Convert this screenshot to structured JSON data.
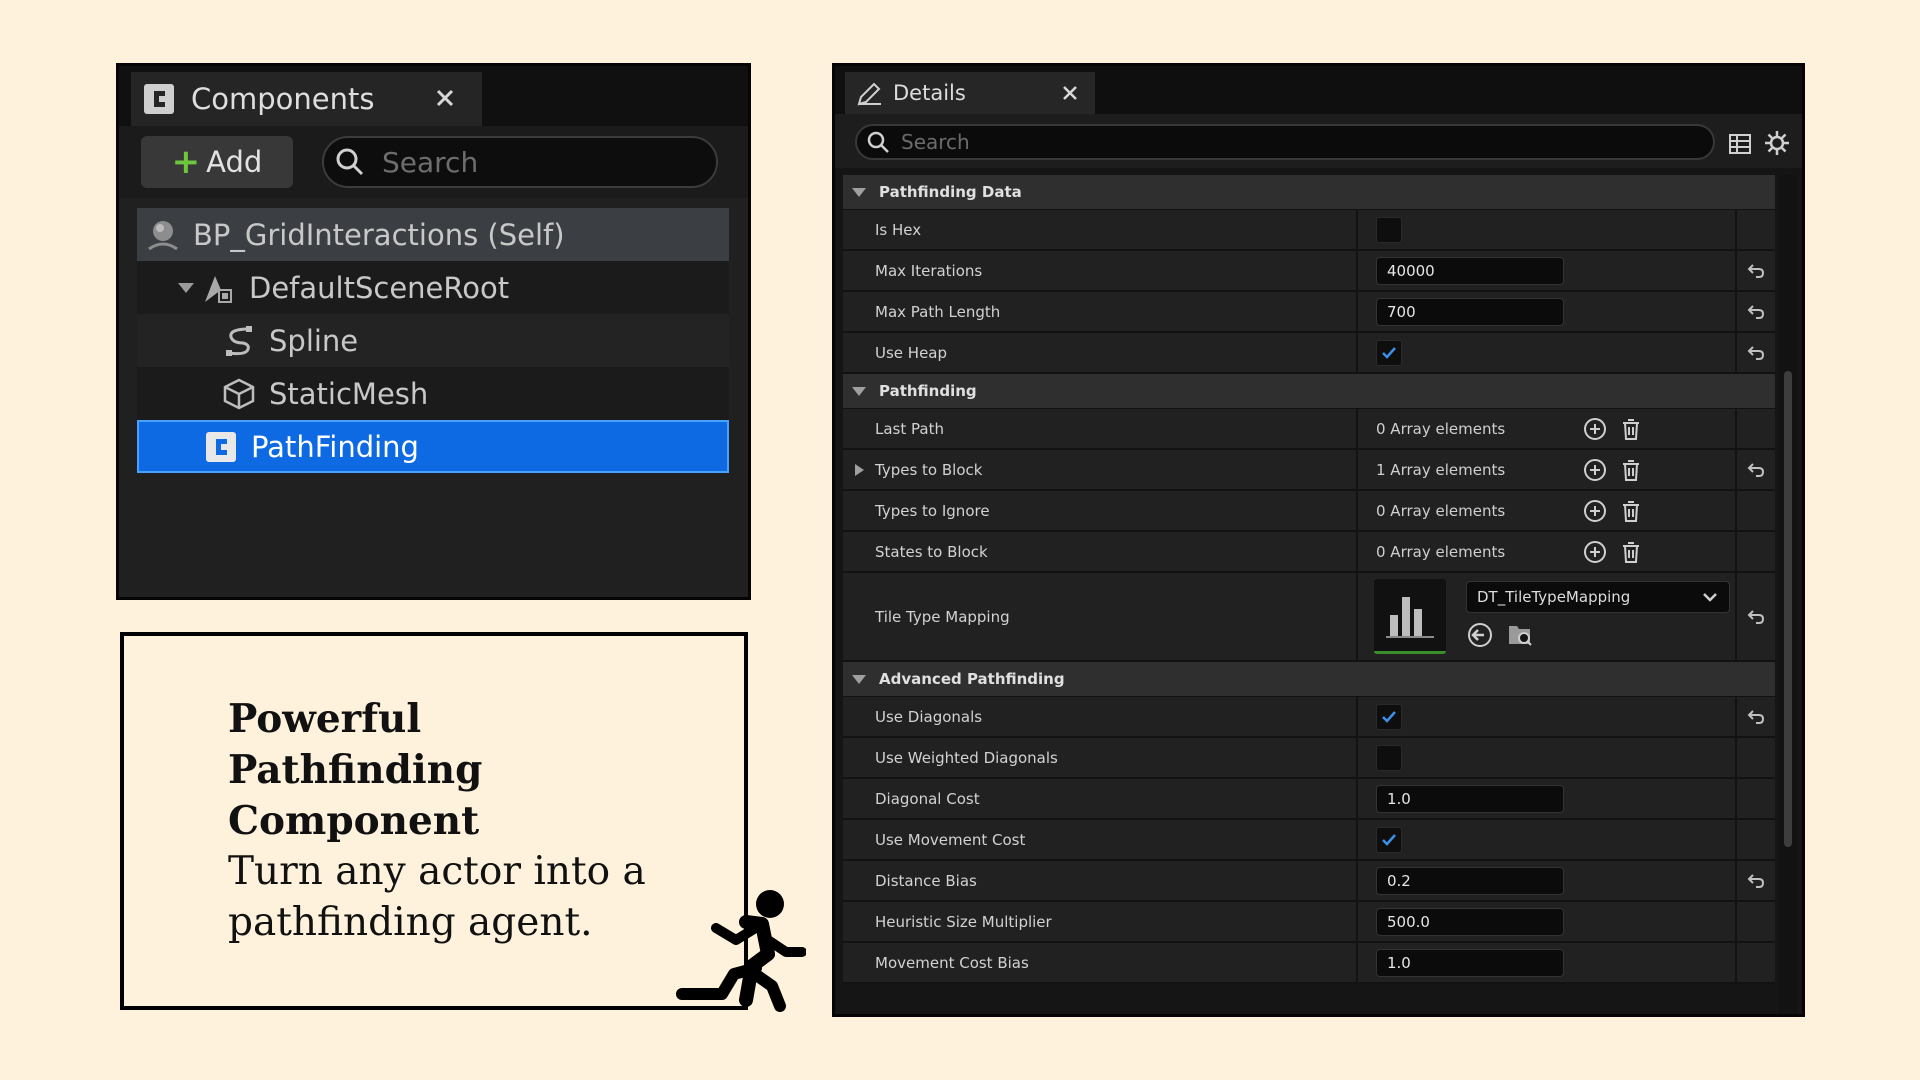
{
  "components_panel": {
    "tab_title": "Components",
    "add_label": "Add",
    "search_placeholder": "Search",
    "tree": [
      {
        "label": "BP_GridInteractions (Self)",
        "icon": "blueprint-self-icon"
      },
      {
        "label": "DefaultSceneRoot",
        "icon": "scene-root-icon"
      },
      {
        "label": "Spline",
        "icon": "spline-icon"
      },
      {
        "label": "StaticMesh",
        "icon": "static-mesh-icon"
      },
      {
        "label": "PathFinding",
        "icon": "actor-component-icon",
        "selected": true
      }
    ]
  },
  "info_box": {
    "title": "Powerful Pathfinding Component",
    "body": "Turn any actor into a pathfinding agent.",
    "icon": "running-person-icon"
  },
  "details_panel": {
    "tab_title": "Details",
    "search_placeholder": "Search",
    "categories": {
      "pathfinding_data": "Pathfinding Data",
      "pathfinding": "Pathfinding",
      "advanced": "Advanced Pathfinding"
    },
    "properties": {
      "is_hex": {
        "label": "Is Hex",
        "checked": false
      },
      "max_iterations": {
        "label": "Max Iterations",
        "value": "40000"
      },
      "max_path_length": {
        "label": "Max Path Length",
        "value": "700"
      },
      "use_heap": {
        "label": "Use Heap",
        "checked": true
      },
      "last_path": {
        "label": "Last Path",
        "value": "0 Array elements"
      },
      "types_to_block": {
        "label": "Types to Block",
        "value": "1 Array elements"
      },
      "types_to_ignore": {
        "label": "Types to Ignore",
        "value": "0 Array elements"
      },
      "states_to_block": {
        "label": "States to Block",
        "value": "0 Array elements"
      },
      "tile_type_mapping": {
        "label": "Tile Type Mapping",
        "value": "DT_TileTypeMapping"
      },
      "use_diagonals": {
        "label": "Use Diagonals",
        "checked": true
      },
      "use_weighted_diagonals": {
        "label": "Use Weighted Diagonals",
        "checked": false
      },
      "diagonal_cost": {
        "label": "Diagonal Cost",
        "value": "1.0"
      },
      "use_movement_cost": {
        "label": "Use Movement Cost",
        "checked": true
      },
      "distance_bias": {
        "label": "Distance Bias",
        "value": "0.2"
      },
      "heuristic_size_multiplier": {
        "label": "Heuristic Size Multiplier",
        "value": "500.0"
      },
      "movement_cost_bias": {
        "label": "Movement Cost Bias",
        "value": "1.0"
      }
    }
  },
  "colors": {
    "background": "#fef2dc",
    "selection": "#0d6ae3",
    "add_plus": "#6ec63c",
    "checkmark": "#3d8fe8",
    "panel": "#202020"
  }
}
